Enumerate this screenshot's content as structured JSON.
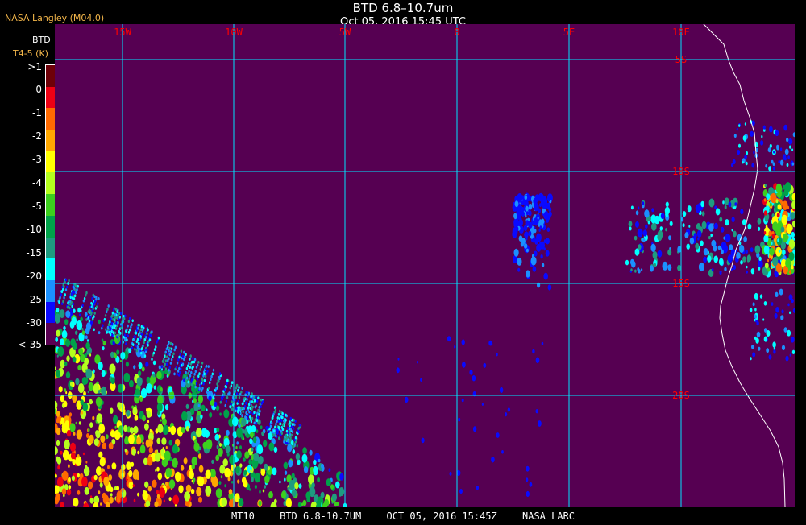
{
  "header": {
    "agency": "NASA Langley (M04.0)",
    "title": "BTD 6.8–10.7um",
    "subtitle": "Oct 05, 2016 15:45 UTC"
  },
  "legend": {
    "label1": "BTD",
    "label2": "T4-5 (K)",
    "ticks": [
      ">1",
      "0",
      "-1",
      "-2",
      "-3",
      "-4",
      "-5",
      "-10",
      "-15",
      "-20",
      "-25",
      "-30",
      "<-35"
    ],
    "colors": [
      "#6e0008",
      "#ee0014",
      "#ff6a00",
      "#ffa800",
      "#ffff00",
      "#b4ff1e",
      "#3ccf1e",
      "#00a24a",
      "#1e9b80",
      "#00ffff",
      "#1a90ff",
      "#0a0aff",
      "#5a0052"
    ]
  },
  "map": {
    "background": "#560052",
    "grid_color": "#00e5ff",
    "label_color": "#ff0000",
    "lon_labels": [
      "15W",
      "10W",
      "5W",
      "0",
      "5E",
      "10E"
    ],
    "lat_labels": [
      "5S",
      "10S",
      "15S",
      "20S"
    ]
  },
  "footer": {
    "sat": "MT10",
    "product": "BTD 6.8-10.7UM",
    "datetime": "OCT 05, 2016 15:45Z",
    "org": "NASA LARC"
  }
}
